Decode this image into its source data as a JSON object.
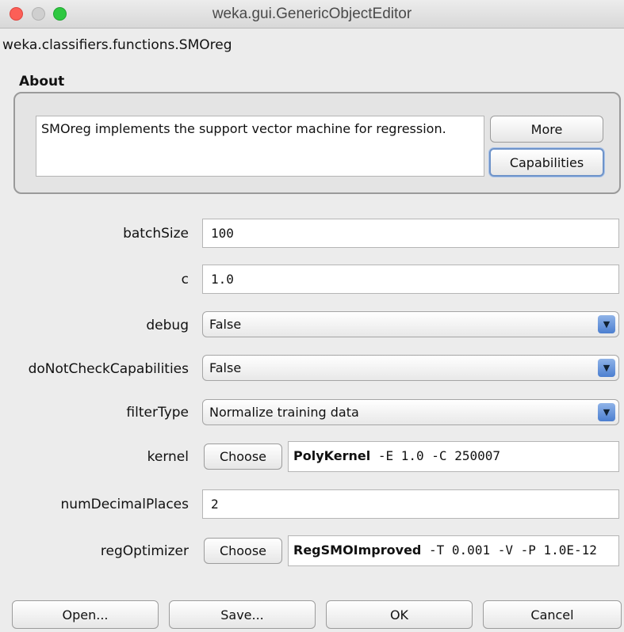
{
  "window": {
    "title": "weka.gui.GenericObjectEditor"
  },
  "class_name": "weka.classifiers.functions.SMOreg",
  "about": {
    "label": "About",
    "description": "SMOreg implements the support vector machine for regression.",
    "more_button": "More",
    "capabilities_button": "Capabilities"
  },
  "properties": {
    "batchSize": {
      "label": "batchSize",
      "value": "100"
    },
    "c": {
      "label": "c",
      "value": "1.0"
    },
    "debug": {
      "label": "debug",
      "value": "False"
    },
    "doNotCheckCapabilities": {
      "label": "doNotCheckCapabilities",
      "value": "False"
    },
    "filterType": {
      "label": "filterType",
      "value": "Normalize training data"
    },
    "kernel": {
      "label": "kernel",
      "choose": "Choose",
      "name": "PolyKernel",
      "options": "-E 1.0 -C 250007"
    },
    "numDecimalPlaces": {
      "label": "numDecimalPlaces",
      "value": "2"
    },
    "regOptimizer": {
      "label": "regOptimizer",
      "choose": "Choose",
      "name": "RegSMOImproved",
      "options": "-T 0.001 -V -P 1.0E-12"
    }
  },
  "footer": {
    "open": "Open...",
    "save": "Save...",
    "ok": "OK",
    "cancel": "Cancel"
  },
  "icons": {
    "dropdown": "chevron-down-icon",
    "close": "close-icon",
    "minimize": "minimize-icon",
    "zoom": "zoom-icon"
  }
}
